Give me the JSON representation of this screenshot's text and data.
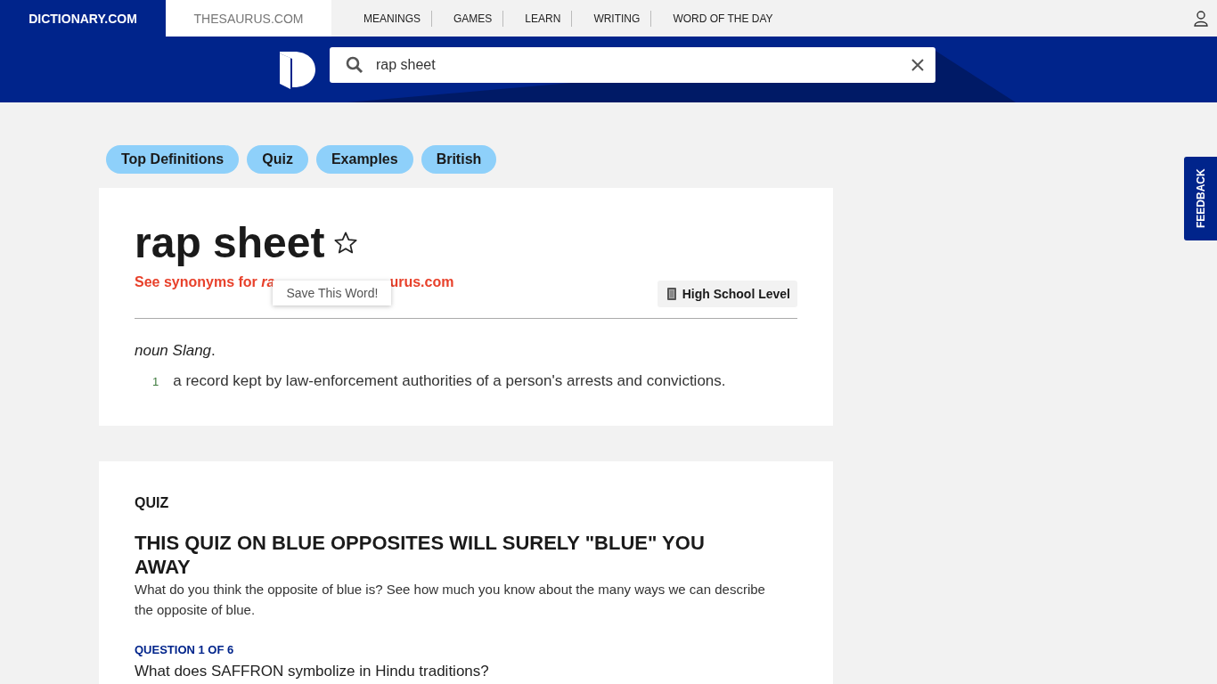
{
  "top_nav": {
    "brand_tabs": [
      {
        "label": "DICTIONARY.COM",
        "selected": true
      },
      {
        "label": "THESAURUS.COM",
        "selected": false
      }
    ],
    "links": [
      "MEANINGS",
      "GAMES",
      "LEARN",
      "WRITING",
      "WORD OF THE DAY"
    ]
  },
  "search": {
    "value": "rap sheet"
  },
  "section_pills": [
    "Top Definitions",
    "Quiz",
    "Examples",
    "British"
  ],
  "entry": {
    "headword": "rap sheet",
    "synonyms_link_start": "See synonyms for *ra*",
    "synonyms_link_end": "urus.com",
    "tooltip": "Save This Word!",
    "level_badge": "High School Level",
    "part_of_speech": "*noun* *Slang*.",
    "definitions": [
      {
        "number": "1",
        "text": "a record kept by law-enforcement authorities of a person's arrests and convictions."
      }
    ]
  },
  "quiz": {
    "label": "QUIZ",
    "title": "THIS QUIZ ON BLUE OPPOSITES WILL SURELY \"BLUE\" YOU AWAY",
    "description": "What do you think the opposite of blue is? See how much you know about the many ways we can describe the opposite of blue.",
    "question_label": "QUESTION 1 OF 6",
    "question": "What does SAFFRON symbolize in Hindu traditions?"
  },
  "feedback_tab": "FEEDBACK"
}
